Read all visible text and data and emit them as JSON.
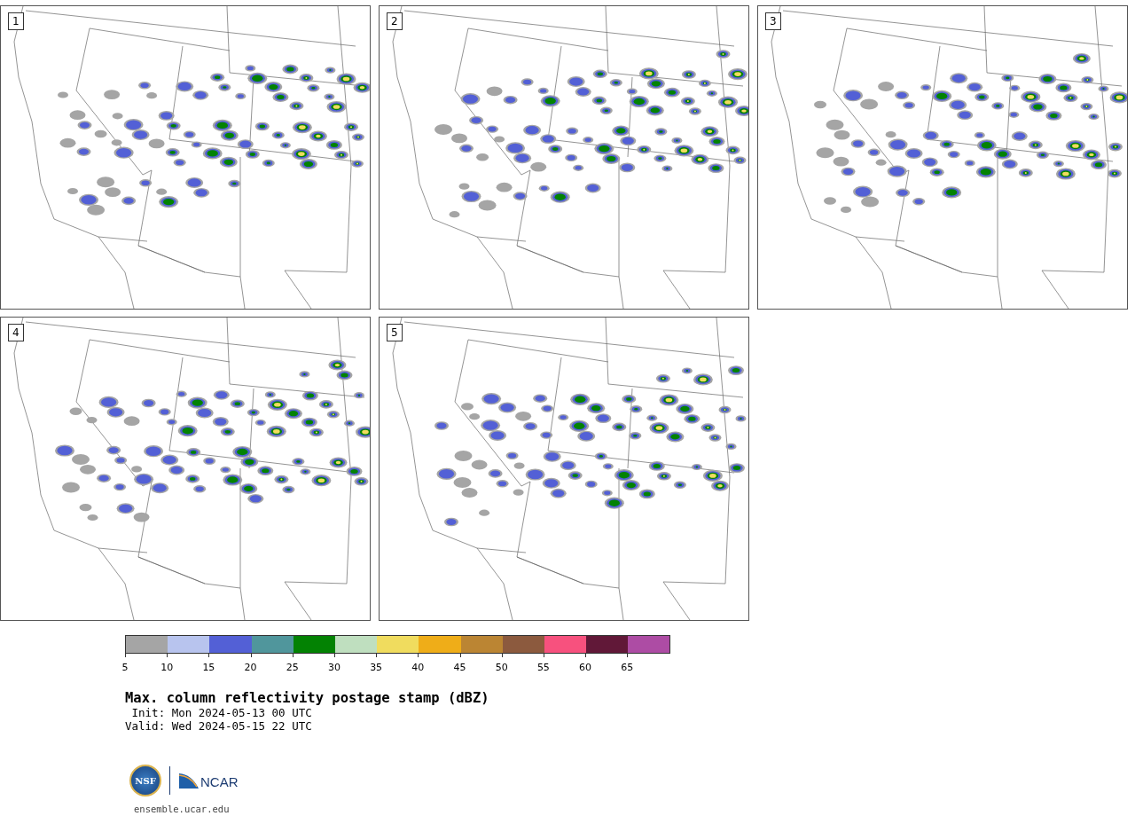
{
  "panels": [
    {
      "label": "1"
    },
    {
      "label": "2"
    },
    {
      "label": "3"
    },
    {
      "label": "4"
    },
    {
      "label": "5"
    }
  ],
  "colorbar": {
    "segments": [
      {
        "color": "#a5a5a5"
      },
      {
        "color": "#b8c4ee"
      },
      {
        "color": "#5360d6"
      },
      {
        "color": "#50969c"
      },
      {
        "color": "#038203"
      },
      {
        "color": "#bfdfbf"
      },
      {
        "color": "#f0dc5e"
      },
      {
        "color": "#efad18"
      },
      {
        "color": "#bb8533"
      },
      {
        "color": "#8c5a3e"
      },
      {
        "color": "#f7517e"
      },
      {
        "color": "#611838"
      },
      {
        "color": "#ad4ca4"
      }
    ],
    "ticks": [
      "5",
      "10",
      "15",
      "20",
      "25",
      "30",
      "35",
      "40",
      "45",
      "50",
      "55",
      "60",
      "65"
    ]
  },
  "title": "Max. column reflectivity postage stamp (dBZ)",
  "init": " Init: Mon 2024-05-13 00 UTC",
  "valid": "Valid: Wed 2024-05-15 22 UTC",
  "logo": {
    "nsf": "NSF",
    "ncar": "NCAR"
  },
  "url": "ensemble.ucar.edu"
}
